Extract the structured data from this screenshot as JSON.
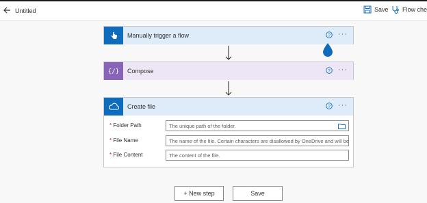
{
  "window": {
    "title": "Untitled"
  },
  "toolbar": {
    "save_label": "Save",
    "flow_checker_label": "Flow chec"
  },
  "steps": [
    {
      "title": "Manually trigger a flow",
      "icon": "hand-pointer-icon",
      "color": "#0f6cbd",
      "header_bg": "#deecf9"
    },
    {
      "title": "Compose",
      "icon": "curly-braces-icon",
      "color": "#8764b8",
      "header_bg": "#ece6f6"
    },
    {
      "title": "Create file",
      "icon": "onedrive-cloud-icon",
      "color": "#0f6cbd",
      "header_bg": "#deecf9"
    }
  ],
  "create_file": {
    "fields": [
      {
        "label": "Folder Path",
        "required": "*",
        "placeholder": "The unique path of the folder."
      },
      {
        "label": "File Name",
        "required": "*",
        "placeholder": "The name of the file. Certain characters are disallowed by OneDrive and will be"
      },
      {
        "label": "File Content",
        "required": "*",
        "placeholder": "The content of the file."
      }
    ]
  },
  "footer": {
    "new_step_label": "+ New step",
    "save_label": "Save"
  },
  "more_glyph": "···"
}
